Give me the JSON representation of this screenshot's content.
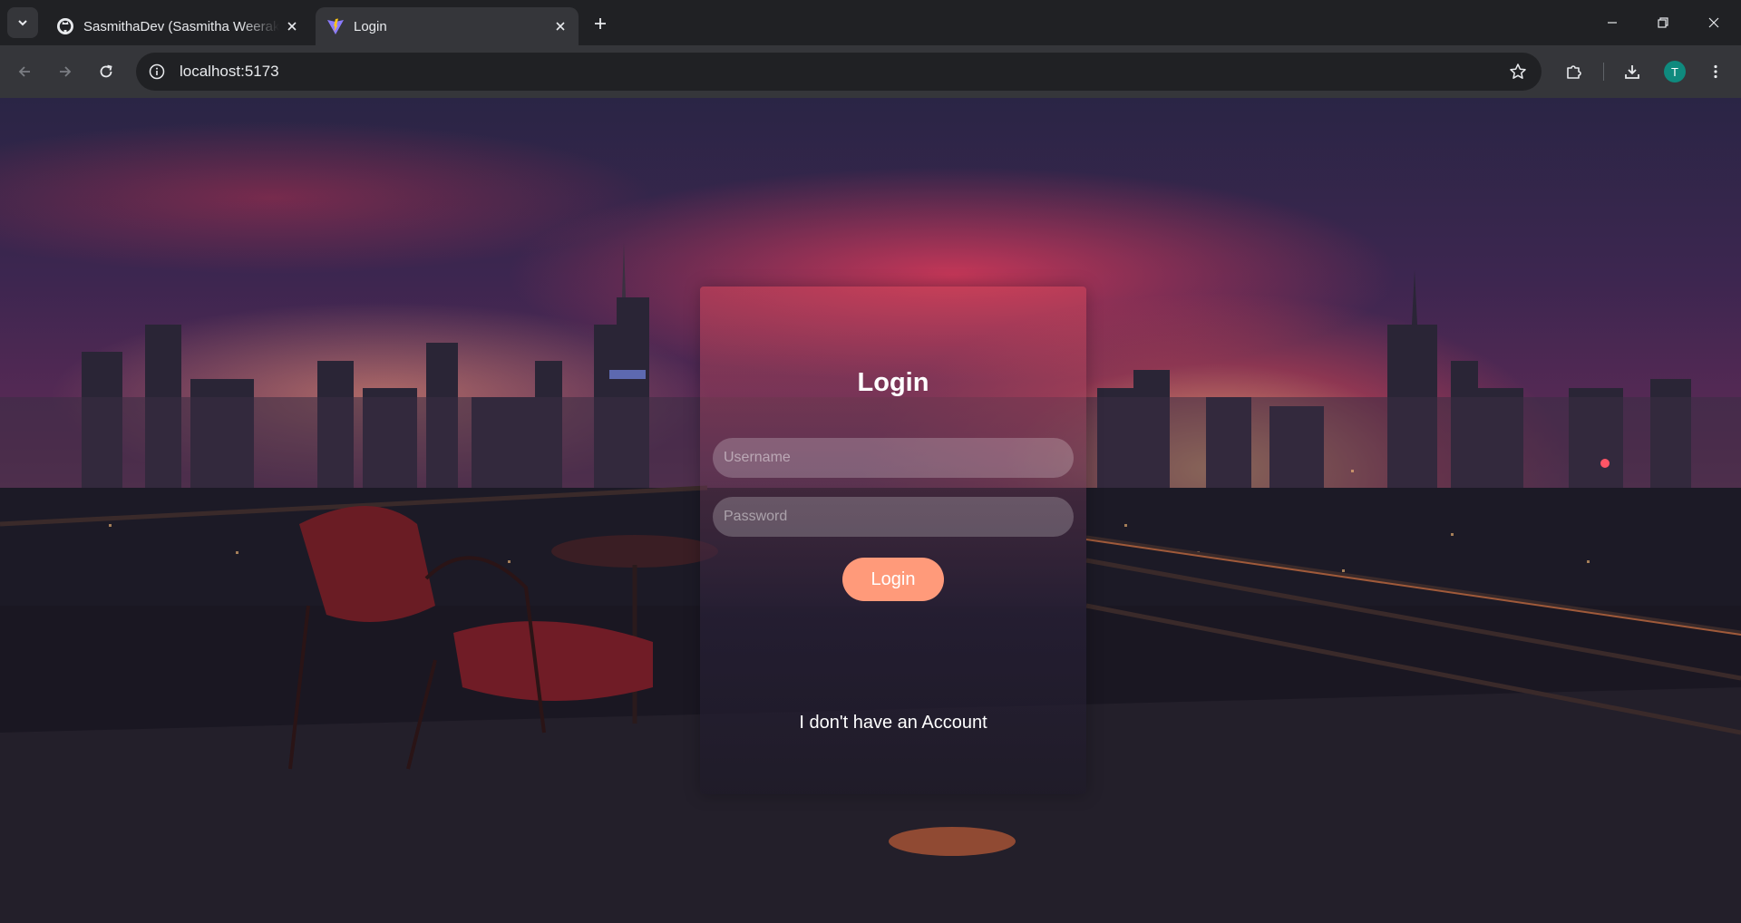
{
  "browser": {
    "tabs": [
      {
        "title": "SasmithaDev (Sasmitha Weerakoon)",
        "icon": "github-icon",
        "active": false
      },
      {
        "title": "Login",
        "icon": "vite-icon",
        "active": true
      }
    ],
    "url": "localhost:5173",
    "profile_initial": "T"
  },
  "login": {
    "title": "Login",
    "username_placeholder": "Username",
    "password_placeholder": "Password",
    "submit_label": "Login",
    "no_account_link": "I don't have an Account"
  },
  "colors": {
    "button": "#ff9a7a",
    "avatar": "#0f8a7e"
  }
}
